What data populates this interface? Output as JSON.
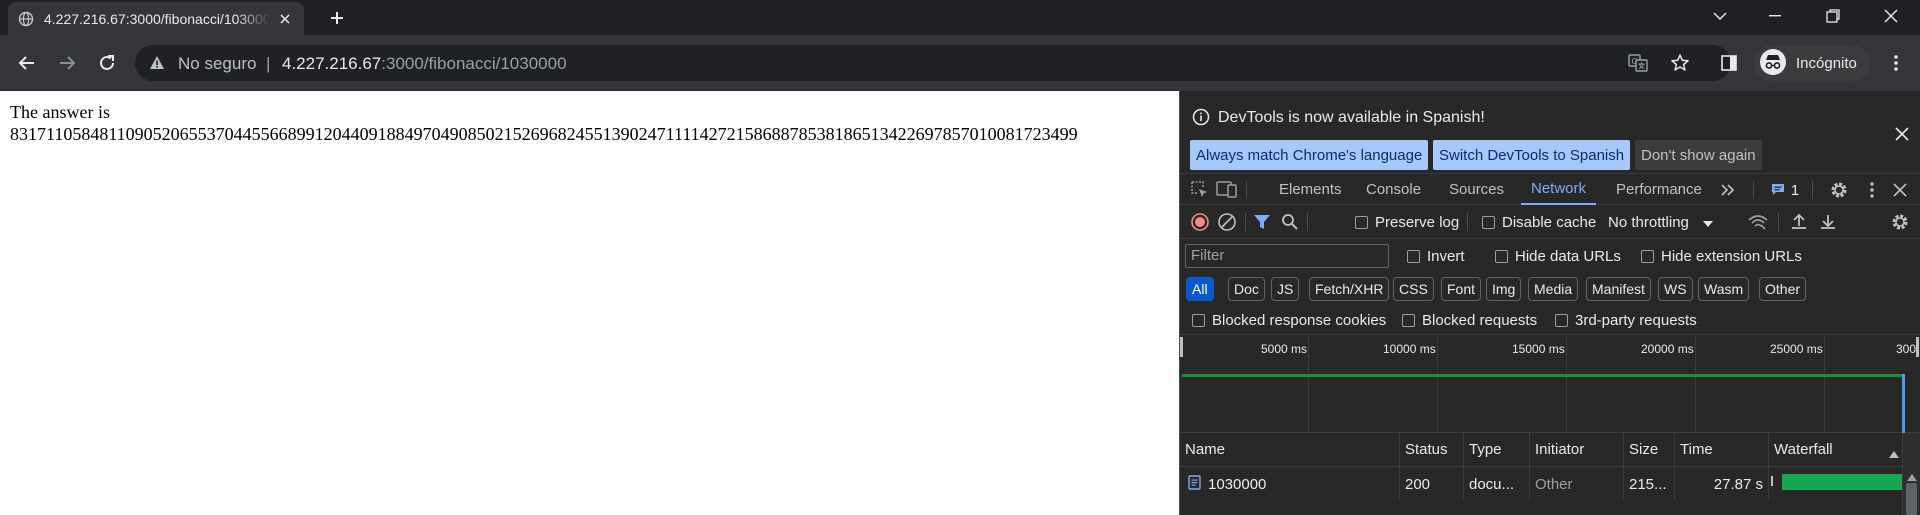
{
  "tab": {
    "title": "4.227.216.67:3000/fibonacci/1030000",
    "icon": "globe-icon"
  },
  "toolbar": {
    "security_label": "No seguro",
    "separator": "|",
    "url_host": "4.227.216.67",
    "url_rest": ":3000/fibonacci/1030000",
    "profile_label": "Incógnito"
  },
  "page": {
    "line1": "The answer is",
    "line2": "83171105848110905206553704455668991204409188497049085021526968245513902471111427215868878538186513422697857010081723499"
  },
  "devtools": {
    "infobar": {
      "message": "DevTools is now available in Spanish!",
      "btn_match": "Always match Chrome's language",
      "btn_switch": "Switch DevTools to Spanish",
      "btn_dismiss": "Don't show again"
    },
    "tabs": [
      "Elements",
      "Console",
      "Sources",
      "Network",
      "Performance"
    ],
    "active_tab": "Network",
    "issues_count": "1",
    "network_toolbar": {
      "preserve_log": "Preserve log",
      "disable_cache": "Disable cache",
      "throttling": "No throttling"
    },
    "filter": {
      "placeholder": "Filter",
      "invert": "Invert",
      "hide_data_urls": "Hide data URLs",
      "hide_extension_urls": "Hide extension URLs"
    },
    "type_filters": [
      "All",
      "Doc",
      "JS",
      "Fetch/XHR",
      "CSS",
      "Font",
      "Img",
      "Media",
      "Manifest",
      "WS",
      "Wasm",
      "Other"
    ],
    "active_type": "All",
    "blocked": {
      "cookies": "Blocked response cookies",
      "requests": "Blocked requests",
      "third_party": "3rd-party requests"
    },
    "timeline_ticks": [
      "5000 ms",
      "10000 ms",
      "15000 ms",
      "20000 ms",
      "25000 ms",
      "300"
    ],
    "columns": [
      "Name",
      "Status",
      "Type",
      "Initiator",
      "Size",
      "Time",
      "Waterfall"
    ],
    "rows": [
      {
        "name": "1030000",
        "status": "200",
        "type": "docu...",
        "initiator": "Other",
        "size": "215...",
        "time": "27.87 s"
      }
    ],
    "colors": {
      "accent": "#7cacf8",
      "waterfall": "#1aa551",
      "chip_active": "#0b57d0"
    }
  }
}
